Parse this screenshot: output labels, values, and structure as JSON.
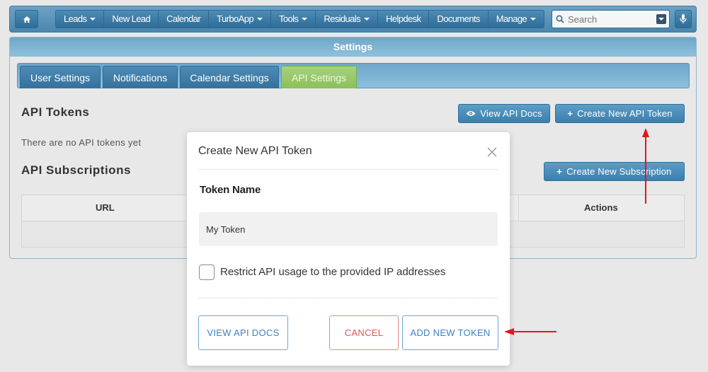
{
  "nav": {
    "home_icon": "home-icon",
    "items": [
      {
        "label": "Leads",
        "dropdown": true
      },
      {
        "label": "New Lead",
        "dropdown": false
      },
      {
        "label": "Calendar",
        "dropdown": false
      },
      {
        "label": "TurboApp",
        "dropdown": true
      },
      {
        "label": "Tools",
        "dropdown": true
      },
      {
        "label": "Residuals",
        "dropdown": true
      },
      {
        "label": "Helpdesk",
        "dropdown": false
      },
      {
        "label": "Documents",
        "dropdown": false
      },
      {
        "label": "Manage",
        "dropdown": true
      }
    ],
    "search_placeholder": "Search"
  },
  "panel": {
    "title": "Settings",
    "tabs": [
      {
        "label": "User Settings",
        "active": false
      },
      {
        "label": "Notifications",
        "active": false
      },
      {
        "label": "Calendar Settings",
        "active": false
      },
      {
        "label": "API Settings",
        "active": true
      }
    ],
    "tokens_title": "API Tokens",
    "view_docs_label": "View API Docs",
    "create_token_label": "Create New API Token",
    "empty_tokens": "There are no API tokens yet",
    "subscriptions_title": "API Subscriptions",
    "create_subscription_label": "Create New Subscription",
    "table_headers": {
      "url": "URL",
      "actions": "Actions"
    }
  },
  "modal": {
    "title": "Create New API Token",
    "field_label": "Token Name",
    "token_value": "My Token",
    "checkbox_label": "Restrict API usage to the provided IP addresses",
    "checkbox_checked": false,
    "btn_docs": "VIEW API DOCS",
    "btn_cancel": "CANCEL",
    "btn_add": "ADD NEW TOKEN"
  },
  "colors": {
    "nav_blue": "#4c86ad",
    "active_tab_green": "#8cc05a",
    "cancel_red": "#e05555",
    "link_blue": "#3b82c4",
    "annotation_red": "#e8141b"
  }
}
